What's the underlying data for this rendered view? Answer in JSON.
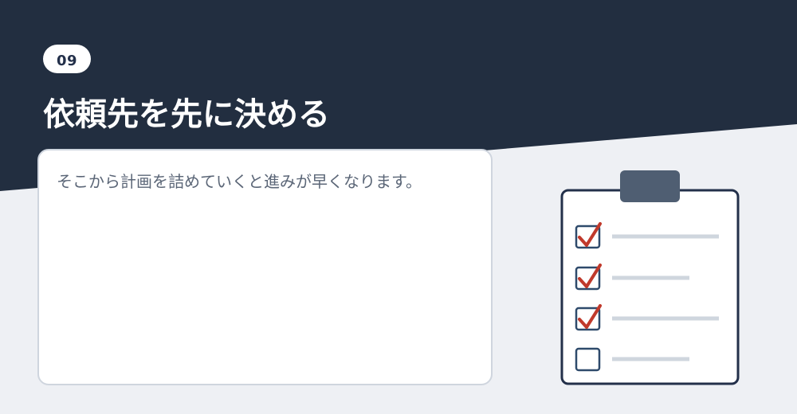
{
  "step": {
    "number": "09"
  },
  "heading": {
    "title": "依頼先を先に決める"
  },
  "card": {
    "text": "そこから計画を詰めていくと進みが早くなります。"
  },
  "illustration": {
    "icon": "clipboard-checklist-icon",
    "items": [
      {
        "checked": true
      },
      {
        "checked": true
      },
      {
        "checked": true
      },
      {
        "checked": false
      }
    ]
  },
  "colors": {
    "header": "#222e40",
    "background": "#eef0f4",
    "card_border": "#cfd5de",
    "badge_text": "#23304a",
    "clipboard_clip": "#4f5e72",
    "check_mark": "#c0392b",
    "checkbox_border": "#2e4a6b",
    "line": "#cfd6de"
  }
}
